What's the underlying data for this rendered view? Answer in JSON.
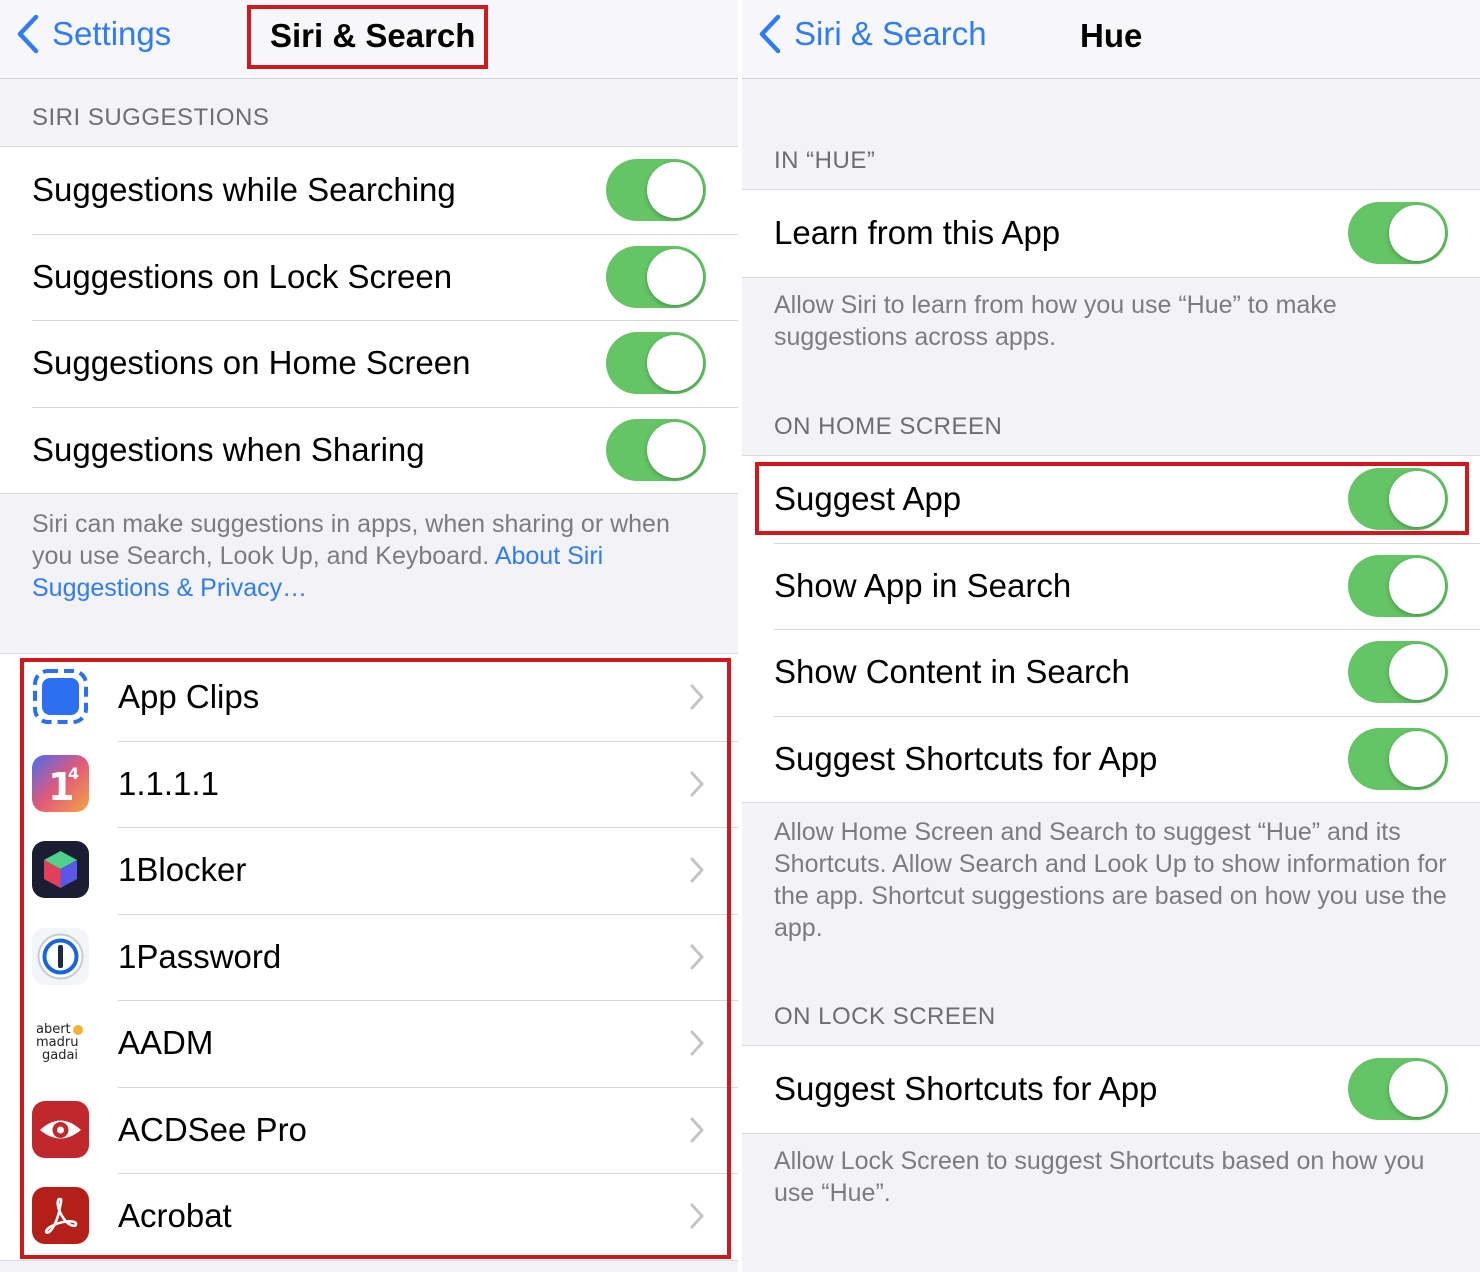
{
  "left": {
    "nav": {
      "back_label": "Settings",
      "title": "Siri & Search"
    },
    "siri_suggestions": {
      "header": "SIRI SUGGESTIONS",
      "rows": [
        {
          "label": "Suggestions while Searching",
          "on": true
        },
        {
          "label": "Suggestions on Lock Screen",
          "on": true
        },
        {
          "label": "Suggestions on Home Screen",
          "on": true
        },
        {
          "label": "Suggestions when Sharing",
          "on": true
        }
      ],
      "footer_text": "Siri can make suggestions in apps, when sharing or when you use Search, Look Up, and Keyboard.",
      "footer_link": "About Siri Suggestions & Privacy…"
    },
    "apps": [
      {
        "name": "App Clips",
        "icon": "app-clips-icon"
      },
      {
        "name": "1.1.1.1",
        "icon": "cloudflare-1111-icon"
      },
      {
        "name": "1Blocker",
        "icon": "1blocker-icon"
      },
      {
        "name": "1Password",
        "icon": "1password-icon"
      },
      {
        "name": "AADM",
        "icon": "aadm-icon",
        "icon_text": "abert madru gadai"
      },
      {
        "name": "ACDSee Pro",
        "icon": "acdsee-icon"
      },
      {
        "name": "Acrobat",
        "icon": "acrobat-icon"
      }
    ]
  },
  "right": {
    "nav": {
      "back_label": "Siri & Search",
      "title": "Hue"
    },
    "in_app": {
      "header": "IN “HUE”",
      "rows": [
        {
          "label": "Learn from this App",
          "on": true
        }
      ],
      "footer": "Allow Siri to learn from how you use “Hue” to make suggestions across apps."
    },
    "home_screen": {
      "header": "ON HOME SCREEN",
      "rows": [
        {
          "label": "Suggest App",
          "on": true
        },
        {
          "label": "Show App in Search",
          "on": true
        },
        {
          "label": "Show Content in Search",
          "on": true
        },
        {
          "label": "Suggest Shortcuts for App",
          "on": true
        }
      ],
      "footer": "Allow Home Screen and Search to suggest “Hue” and its Shortcuts. Allow Search and Look Up to show information for the app. Shortcut suggestions are based on how you use the app."
    },
    "lock_screen": {
      "header": "ON LOCK SCREEN",
      "rows": [
        {
          "label": "Suggest Shortcuts for App",
          "on": true
        }
      ],
      "footer": "Allow Lock Screen to suggest Shortcuts based on how you use “Hue”."
    }
  },
  "colors": {
    "accent": "#2f7cf6",
    "toggle_on": "#65c466",
    "highlight": "#d0181f",
    "background": "#f2f2f7"
  }
}
